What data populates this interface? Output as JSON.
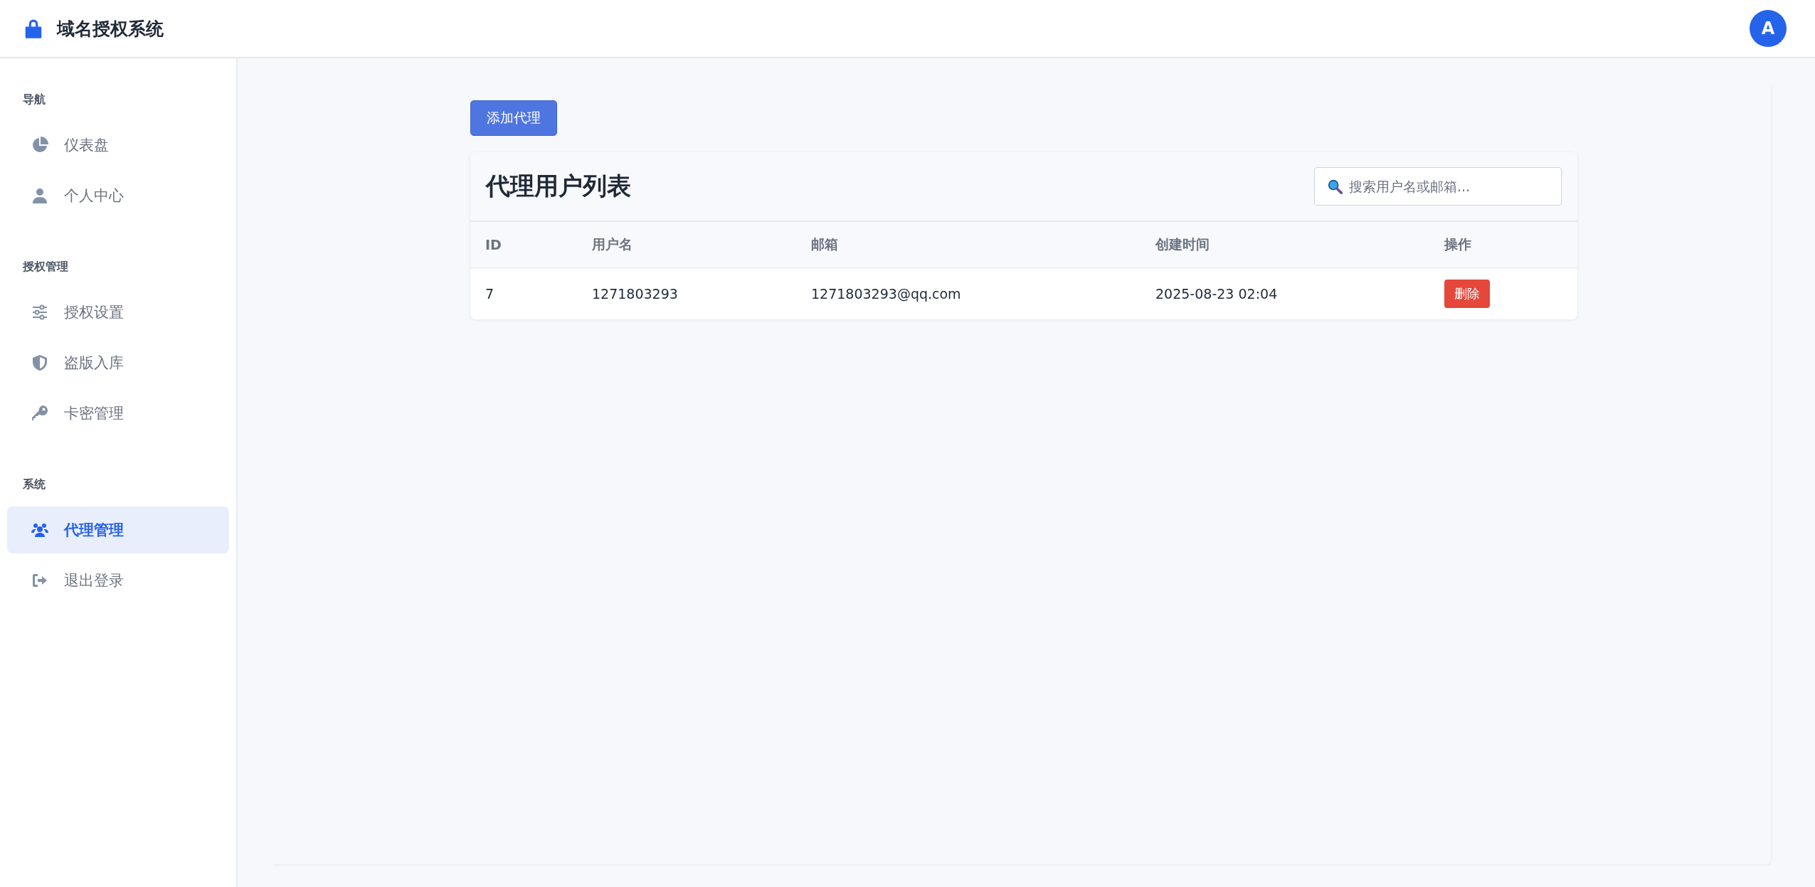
{
  "header": {
    "title": "域名授权系统",
    "avatar": "A"
  },
  "sidebar": {
    "sections": [
      {
        "label": "导航",
        "items": [
          {
            "label": "仪表盘",
            "kind": "pie",
            "selected": false
          },
          {
            "label": "个人中心",
            "kind": "user",
            "selected": false
          }
        ]
      },
      {
        "label": "授权管理",
        "items": [
          {
            "label": "授权设置",
            "kind": "sliders",
            "selected": false
          },
          {
            "label": "盗版入库",
            "kind": "shield",
            "selected": false
          },
          {
            "label": "卡密管理",
            "kind": "key",
            "selected": false
          }
        ]
      },
      {
        "label": "系统",
        "items": [
          {
            "label": "代理管理",
            "kind": "users",
            "selected": true
          },
          {
            "label": "退出登录",
            "kind": "logout",
            "selected": false
          }
        ]
      }
    ]
  },
  "add_button": "添加代理",
  "card": {
    "title": "代理用户列表",
    "search": {
      "placeholder": "搜索用户名或邮箱..."
    },
    "table": {
      "columns": [
        "ID",
        "用户名",
        "邮箱",
        "创建时间",
        "操作"
      ],
      "rows": [
        {
          "cells": [
            "7",
            "1271803293",
            "1271803293@qq.com",
            "2025-08-23 02:04"
          ],
          "action": "删除"
        }
      ]
    }
  }
}
